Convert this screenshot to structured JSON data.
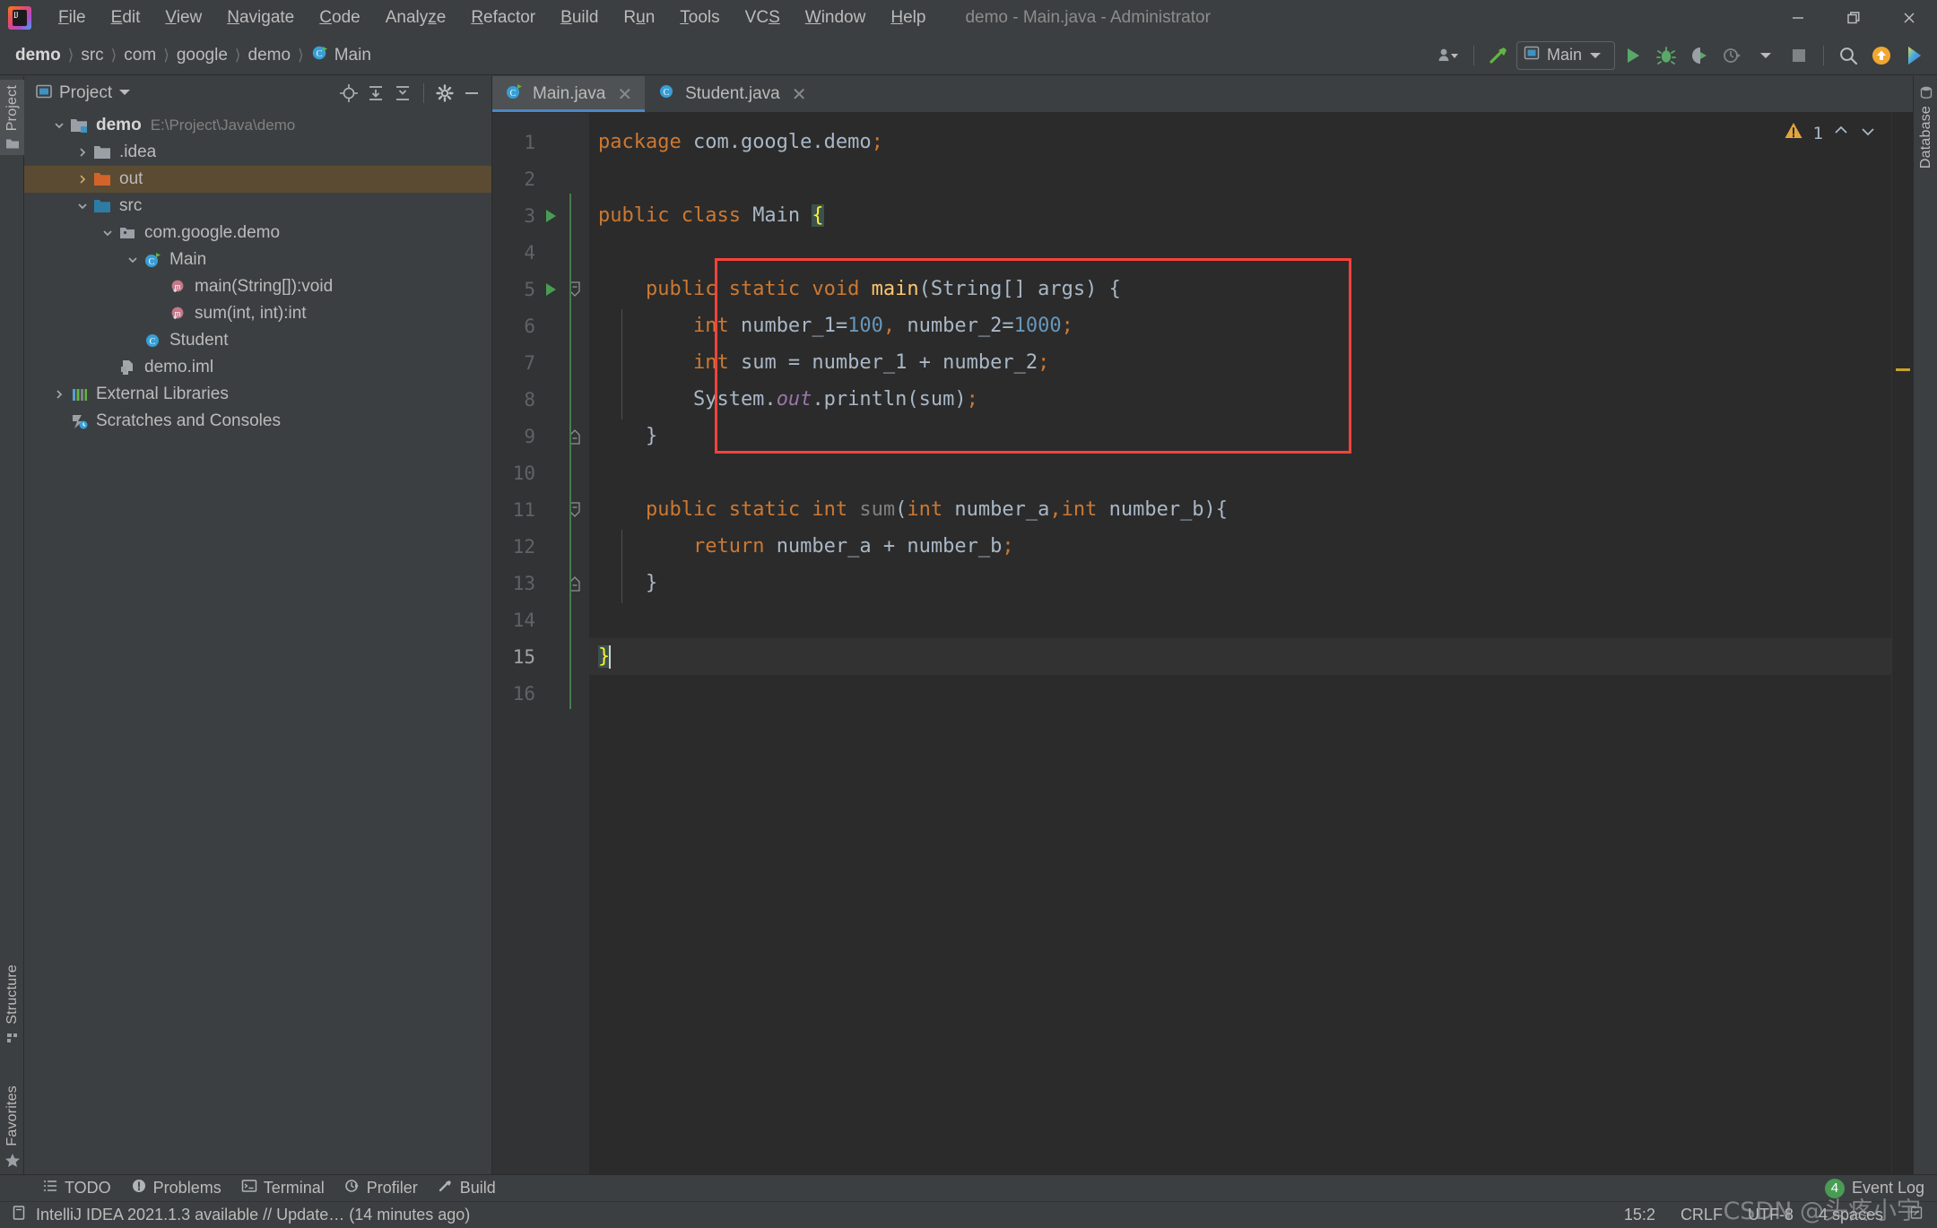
{
  "window": {
    "title": "demo - Main.java - Administrator",
    "controls": {
      "minimize": "minimize-button",
      "restore": "restore-button",
      "close": "close-button"
    }
  },
  "menubar": {
    "items": [
      {
        "label": "File",
        "mnemonic": "F"
      },
      {
        "label": "Edit",
        "mnemonic": "E"
      },
      {
        "label": "View",
        "mnemonic": "V"
      },
      {
        "label": "Navigate",
        "mnemonic": "N"
      },
      {
        "label": "Code",
        "mnemonic": "C"
      },
      {
        "label": "Analyze",
        "mnemonic": "z"
      },
      {
        "label": "Refactor",
        "mnemonic": "R"
      },
      {
        "label": "Build",
        "mnemonic": "B"
      },
      {
        "label": "Run",
        "mnemonic": "u"
      },
      {
        "label": "Tools",
        "mnemonic": "T"
      },
      {
        "label": "VCS",
        "mnemonic": "S"
      },
      {
        "label": "Window",
        "mnemonic": "W"
      },
      {
        "label": "Help",
        "mnemonic": "H"
      }
    ]
  },
  "breadcrumb": {
    "items": [
      "demo",
      "src",
      "com",
      "google",
      "demo",
      "Main"
    ],
    "separator": "〉"
  },
  "toolbar": {
    "run_configuration": "Main",
    "buttons": [
      "user-dropdown-button",
      "build-hammer-button",
      "run-button",
      "debug-button",
      "run-with-coverage-button",
      "profiler-button",
      "stop-button",
      "search-everywhere-button",
      "update-button",
      "ide-button"
    ]
  },
  "project_panel": {
    "title": "Project",
    "tools": [
      "locate-icon",
      "expand-all-icon",
      "collapse-all-icon",
      "settings-gear-icon",
      "hide-icon"
    ],
    "tree": [
      {
        "label": "demo",
        "path": "E:\\Project\\Java\\demo",
        "depth": 0,
        "twist": "down",
        "icon": "module-folder",
        "bold": true,
        "selected": false
      },
      {
        "label": ".idea",
        "path": "",
        "depth": 1,
        "twist": "right",
        "icon": "folder-gray",
        "bold": false,
        "selected": false
      },
      {
        "label": "out",
        "path": "",
        "depth": 1,
        "twist": "right",
        "icon": "folder-orange",
        "bold": false,
        "selected": true
      },
      {
        "label": "src",
        "path": "",
        "depth": 1,
        "twist": "down",
        "icon": "folder-blue",
        "bold": false,
        "selected": false
      },
      {
        "label": "com.google.demo",
        "path": "",
        "depth": 2,
        "twist": "down",
        "icon": "package",
        "bold": false,
        "selected": false
      },
      {
        "label": "Main",
        "path": "",
        "depth": 3,
        "twist": "down",
        "icon": "class-runnable",
        "bold": false,
        "selected": false
      },
      {
        "label": "main(String[]):void",
        "path": "",
        "depth": 4,
        "twist": "none",
        "icon": "method",
        "bold": false,
        "selected": false
      },
      {
        "label": "sum(int, int):int",
        "path": "",
        "depth": 4,
        "twist": "none",
        "icon": "method",
        "bold": false,
        "selected": false
      },
      {
        "label": "Student",
        "path": "",
        "depth": 3,
        "twist": "none",
        "icon": "class",
        "bold": false,
        "selected": false
      },
      {
        "label": "demo.iml",
        "path": "",
        "depth": 2,
        "twist": "none",
        "icon": "iml-file",
        "bold": false,
        "selected": false
      },
      {
        "label": "External Libraries",
        "path": "",
        "depth": 0,
        "twist": "right",
        "icon": "libraries",
        "bold": false,
        "selected": false
      },
      {
        "label": "Scratches and Consoles",
        "path": "",
        "depth": 0,
        "twist": "none",
        "icon": "scratches",
        "bold": false,
        "selected": false
      }
    ]
  },
  "left_stripe": {
    "tabs": [
      "Project",
      "Structure",
      "Favorites"
    ]
  },
  "right_stripe": {
    "tabs": [
      "Database"
    ]
  },
  "editor": {
    "tabs": [
      {
        "label": "Main.java",
        "active": true,
        "icon": "class-runnable"
      },
      {
        "label": "Student.java",
        "active": false,
        "icon": "class"
      }
    ],
    "inspection": {
      "warning_count": "1",
      "icon": "warning-triangle"
    },
    "caret_line": 15,
    "lines": [
      {
        "n": 1,
        "run": false,
        "fold": "",
        "text": "package com.google.demo;"
      },
      {
        "n": 2,
        "run": false,
        "fold": "",
        "text": ""
      },
      {
        "n": 3,
        "run": true,
        "fold": "",
        "text": "public class Main {"
      },
      {
        "n": 4,
        "run": false,
        "fold": "",
        "text": ""
      },
      {
        "n": 5,
        "run": true,
        "fold": "minus",
        "text": "    public static void main(String[] args) {"
      },
      {
        "n": 6,
        "run": false,
        "fold": "",
        "text": "        int number_1=100, number_2=1000;"
      },
      {
        "n": 7,
        "run": false,
        "fold": "",
        "text": "        int sum = number_1 + number_2;"
      },
      {
        "n": 8,
        "run": false,
        "fold": "",
        "text": "        System.out.println(sum);"
      },
      {
        "n": 9,
        "run": false,
        "fold": "end",
        "text": "    }"
      },
      {
        "n": 10,
        "run": false,
        "fold": "",
        "text": ""
      },
      {
        "n": 11,
        "run": false,
        "fold": "minus",
        "text": "    public static int sum(int number_a,int number_b){"
      },
      {
        "n": 12,
        "run": false,
        "fold": "",
        "text": "        return number_a + number_b;"
      },
      {
        "n": 13,
        "run": false,
        "fold": "end",
        "text": "    }"
      },
      {
        "n": 14,
        "run": false,
        "fold": "",
        "text": ""
      },
      {
        "n": 15,
        "run": false,
        "fold": "",
        "text": "}"
      },
      {
        "n": 16,
        "run": false,
        "fold": "",
        "text": ""
      }
    ]
  },
  "annotation": {
    "color": "#f9423a",
    "shape": "rectangle",
    "wraps_lines": "5-9"
  },
  "tool_window_bar": {
    "buttons": [
      {
        "label": "TODO",
        "icon": "todo-list-icon"
      },
      {
        "label": "Problems",
        "icon": "problems-icon"
      },
      {
        "label": "Terminal",
        "icon": "terminal-icon"
      },
      {
        "label": "Profiler",
        "icon": "profiler-icon"
      },
      {
        "label": "Build",
        "icon": "build-hammer-icon"
      }
    ],
    "event_log": {
      "label": "Event Log",
      "count": "4"
    }
  },
  "statusbar": {
    "message": "IntelliJ IDEA 2021.1.3 available // Update… (14 minutes ago)",
    "message_icon": "notification-icon",
    "caret_position": "15:2",
    "line_separator": "CRLF",
    "encoding": "UTF-8",
    "indent": "4 spaces",
    "lock_icon": "read-only-toggle"
  },
  "watermark": {
    "text": "CSDN @头疼小宇"
  }
}
